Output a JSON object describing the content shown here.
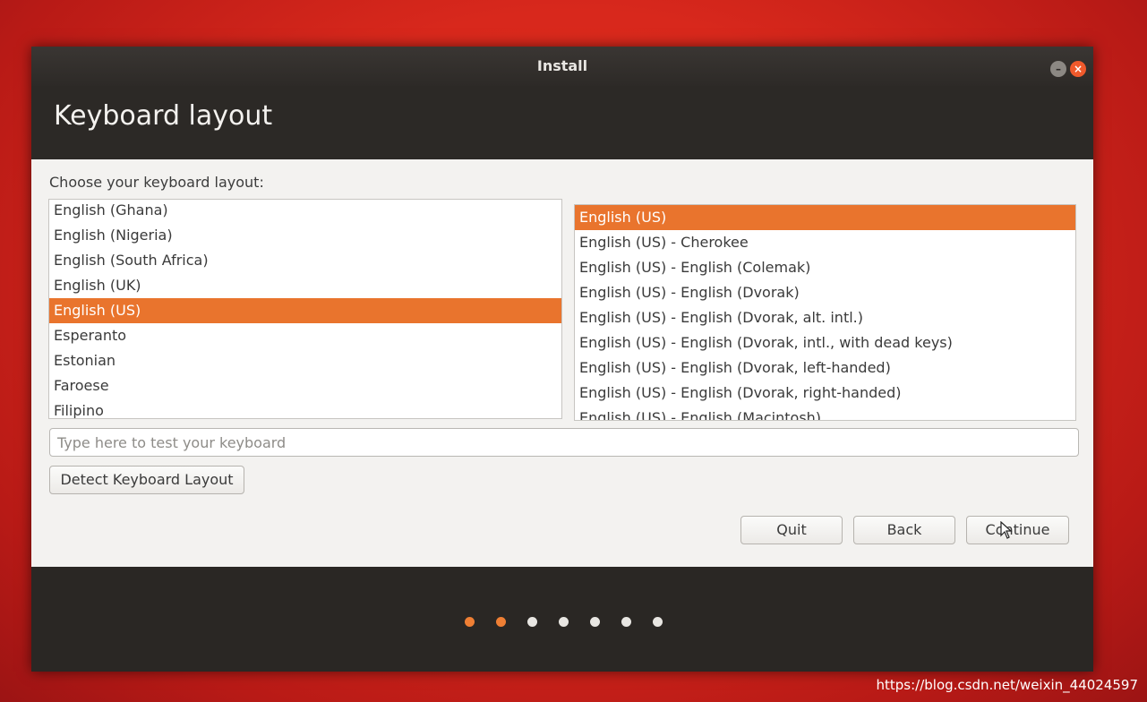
{
  "window": {
    "title": "Install"
  },
  "header": {
    "title": "Keyboard layout"
  },
  "content": {
    "prompt": "Choose your keyboard layout:",
    "layouts": [
      {
        "label": "English (Ghana)",
        "selected": false
      },
      {
        "label": "English (Nigeria)",
        "selected": false
      },
      {
        "label": "English (South Africa)",
        "selected": false
      },
      {
        "label": "English (UK)",
        "selected": false
      },
      {
        "label": "English (US)",
        "selected": true
      },
      {
        "label": "Esperanto",
        "selected": false
      },
      {
        "label": "Estonian",
        "selected": false
      },
      {
        "label": "Faroese",
        "selected": false
      },
      {
        "label": "Filipino",
        "selected": false
      }
    ],
    "variants": [
      {
        "label": "English (US)",
        "selected": true
      },
      {
        "label": "English (US) - Cherokee",
        "selected": false
      },
      {
        "label": "English (US) - English (Colemak)",
        "selected": false
      },
      {
        "label": "English (US) - English (Dvorak)",
        "selected": false
      },
      {
        "label": "English (US) - English (Dvorak, alt. intl.)",
        "selected": false
      },
      {
        "label": "English (US) - English (Dvorak, intl., with dead keys)",
        "selected": false
      },
      {
        "label": "English (US) - English (Dvorak, left-handed)",
        "selected": false
      },
      {
        "label": "English (US) - English (Dvorak, right-handed)",
        "selected": false
      },
      {
        "label": "English (US) - English (Macintosh)",
        "selected": false
      }
    ],
    "test_input": {
      "value": "",
      "placeholder": "Type here to test your keyboard"
    },
    "detect_label": "Detect Keyboard Layout"
  },
  "buttons": {
    "quit": "Quit",
    "back": "Back",
    "continue": "Continue"
  },
  "progress": {
    "total_steps": 7,
    "completed_steps": 2
  },
  "colors": {
    "accent": "#e9742d",
    "background": "#d8281c",
    "chrome": "#2a2724"
  },
  "watermark": "https://blog.csdn.net/weixin_44024597"
}
